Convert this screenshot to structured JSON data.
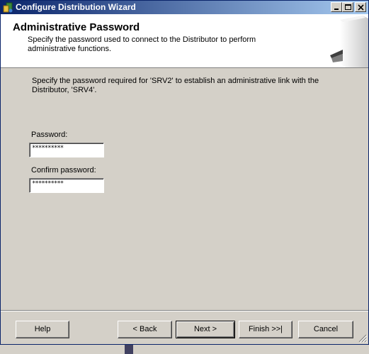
{
  "window": {
    "title": "Configure Distribution Wizard",
    "icon": "wizard-app-icon"
  },
  "title_buttons": {
    "minimize": "minimize-icon",
    "maximize": "maximize-icon",
    "close": "close-icon"
  },
  "header": {
    "title": "Administrative Password",
    "subtitle": "Specify the password used to connect to the Distributor to perform administrative functions.",
    "art": "server-wizard-graphic"
  },
  "content": {
    "description": "Specify the password required for 'SRV2' to establish an administrative link with the Distributor, 'SRV4'.",
    "password_label": "Password:",
    "password_value": "**********",
    "confirm_label": "Confirm password:",
    "confirm_value": "**********"
  },
  "buttons": {
    "help": "Help",
    "back": "< Back",
    "next": "Next >",
    "finish": "Finish >>|",
    "cancel": "Cancel"
  },
  "colors": {
    "titlebar_start": "#0a246a",
    "titlebar_end": "#a6caf0",
    "face": "#d4d0c8"
  }
}
